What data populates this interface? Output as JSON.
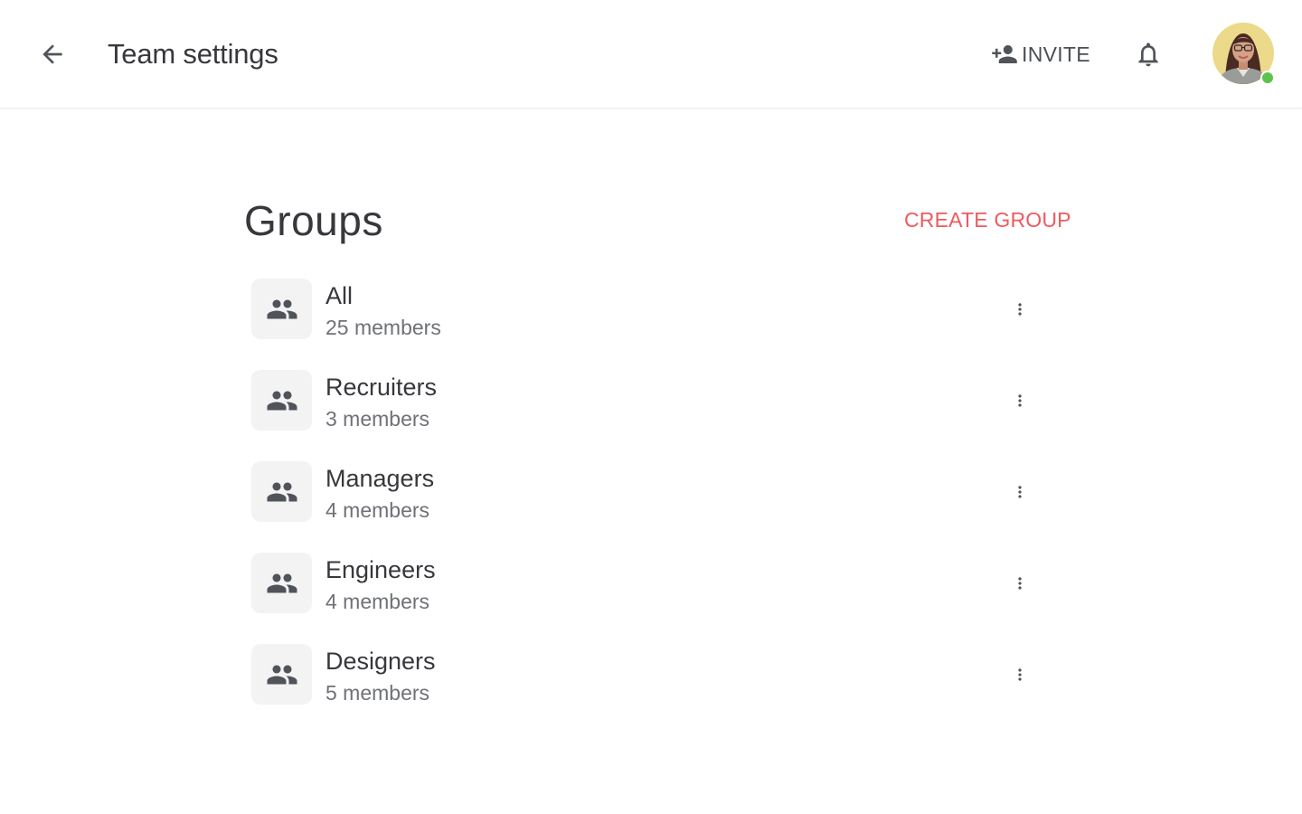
{
  "header": {
    "back_icon": "arrow-left-icon",
    "title": "Team settings",
    "invite_label": "INVITE",
    "invite_icon": "person-add-icon",
    "bell_icon": "bell-icon",
    "avatar_status": "online"
  },
  "groups_section": {
    "title": "Groups",
    "create_label": "CREATE GROUP",
    "groups": [
      {
        "name": "All",
        "count": "25 members"
      },
      {
        "name": "Recruiters",
        "count": "3 members"
      },
      {
        "name": "Managers",
        "count": "4 members"
      },
      {
        "name": "Engineers",
        "count": "4 members"
      },
      {
        "name": "Designers",
        "count": "5 members"
      }
    ]
  },
  "colors": {
    "accent": "#ee5a5f",
    "text": "#37383c",
    "muted": "#6f7178",
    "icon": "#50535a",
    "online": "#5cc349"
  }
}
